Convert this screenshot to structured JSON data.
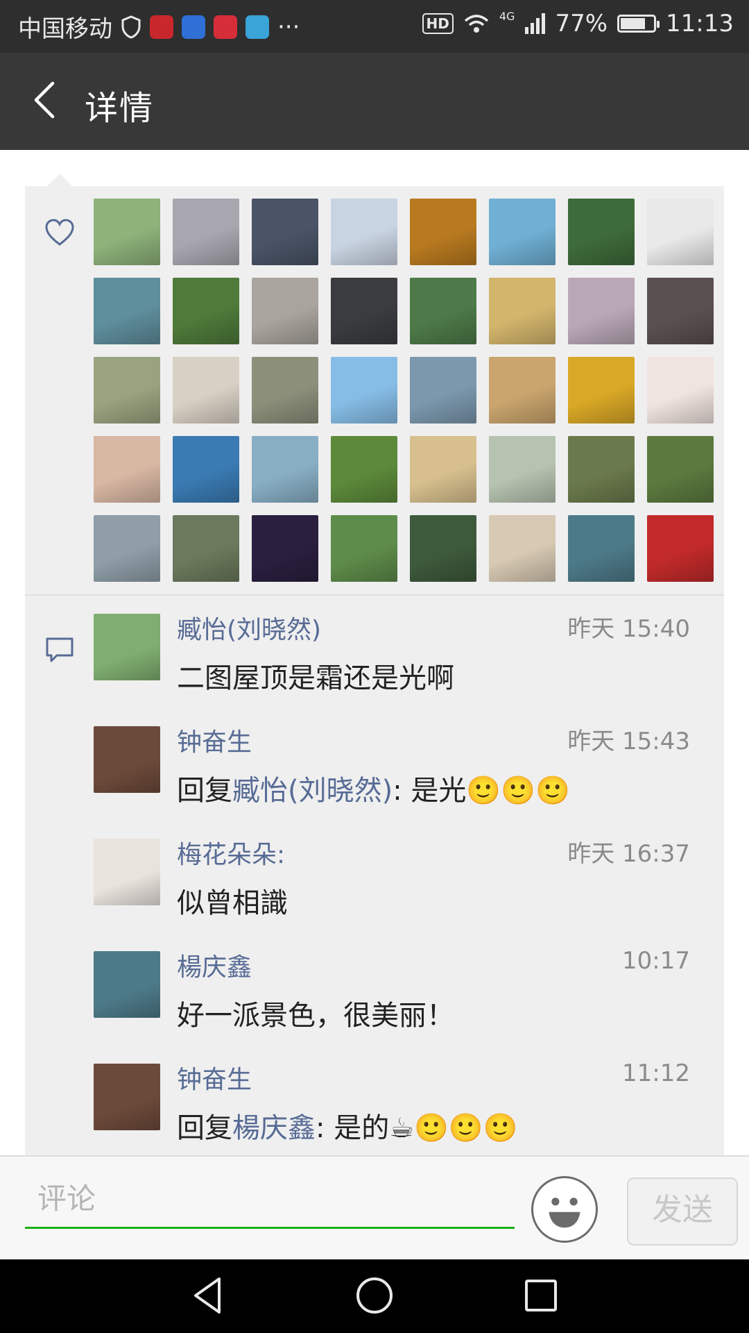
{
  "status_bar": {
    "carrier": "中国移动",
    "more": "···",
    "hd": "HD",
    "network": "4G",
    "battery_percent": "77%",
    "battery_level": 0.77,
    "time": "11:13"
  },
  "title_bar": {
    "title": "详情"
  },
  "likes": {
    "avatar_colors": [
      "#8db27a",
      "#a8a7b0",
      "#4a5466",
      "#c9d4e2",
      "#b97a1f",
      "#6fb0d4",
      "#3e6b3a",
      "#e9e9e9",
      "#5f8e9c",
      "#4e7a3a",
      "#a9a49d",
      "#3a3c40",
      "#4d7a48",
      "#d3b56c",
      "#b9a7b6",
      "#5a5050",
      "#9aa37f",
      "#d8d0c4",
      "#8c8f7a",
      "#86bde6",
      "#7b98ad",
      "#caa56d",
      "#d9a826",
      "#f0e4df",
      "#d8b7a3",
      "#3a7bb3",
      "#88aec4",
      "#5c8a3a",
      "#d7c08e",
      "#b6c3b0",
      "#6b7a4c",
      "#5c7a3f",
      "#8f9ea8",
      "#6b7a5c",
      "#2a1f3f",
      "#5e8c4a",
      "#3e5a3c",
      "#d7c9b3",
      "#4d7a88",
      "#c22a2a"
    ]
  },
  "comments": [
    {
      "name": "臧怡(刘晓然)",
      "time": "昨天 15:40",
      "text": "二图屋顶是霜还是光啊",
      "avatar_color": "#7fae70"
    },
    {
      "name": "钟奋生",
      "time": "昨天 15:43",
      "reply_prefix": "回复",
      "reply_to": "臧怡(刘晓然)",
      "text": ": 是光",
      "emojis": "🙂🙂🙂",
      "avatar_color": "#6c4a3a"
    },
    {
      "name": "梅花朵朵:",
      "time": "昨天 16:37",
      "text": "似曾相識",
      "avatar_color": "#e9e3dd"
    },
    {
      "name": "楊庆鑫",
      "time": "10:17",
      "text": "好一派景色，很美丽！",
      "avatar_color": "#4d7a88"
    },
    {
      "name": "钟奋生",
      "time": "11:12",
      "reply_prefix": "回复",
      "reply_to": "楊庆鑫",
      "text": ": 是的",
      "emojis": "☕🙂🙂🙂",
      "avatar_color": "#6c4a3a"
    }
  ],
  "input_bar": {
    "placeholder": "评论",
    "send_label": "发送"
  }
}
